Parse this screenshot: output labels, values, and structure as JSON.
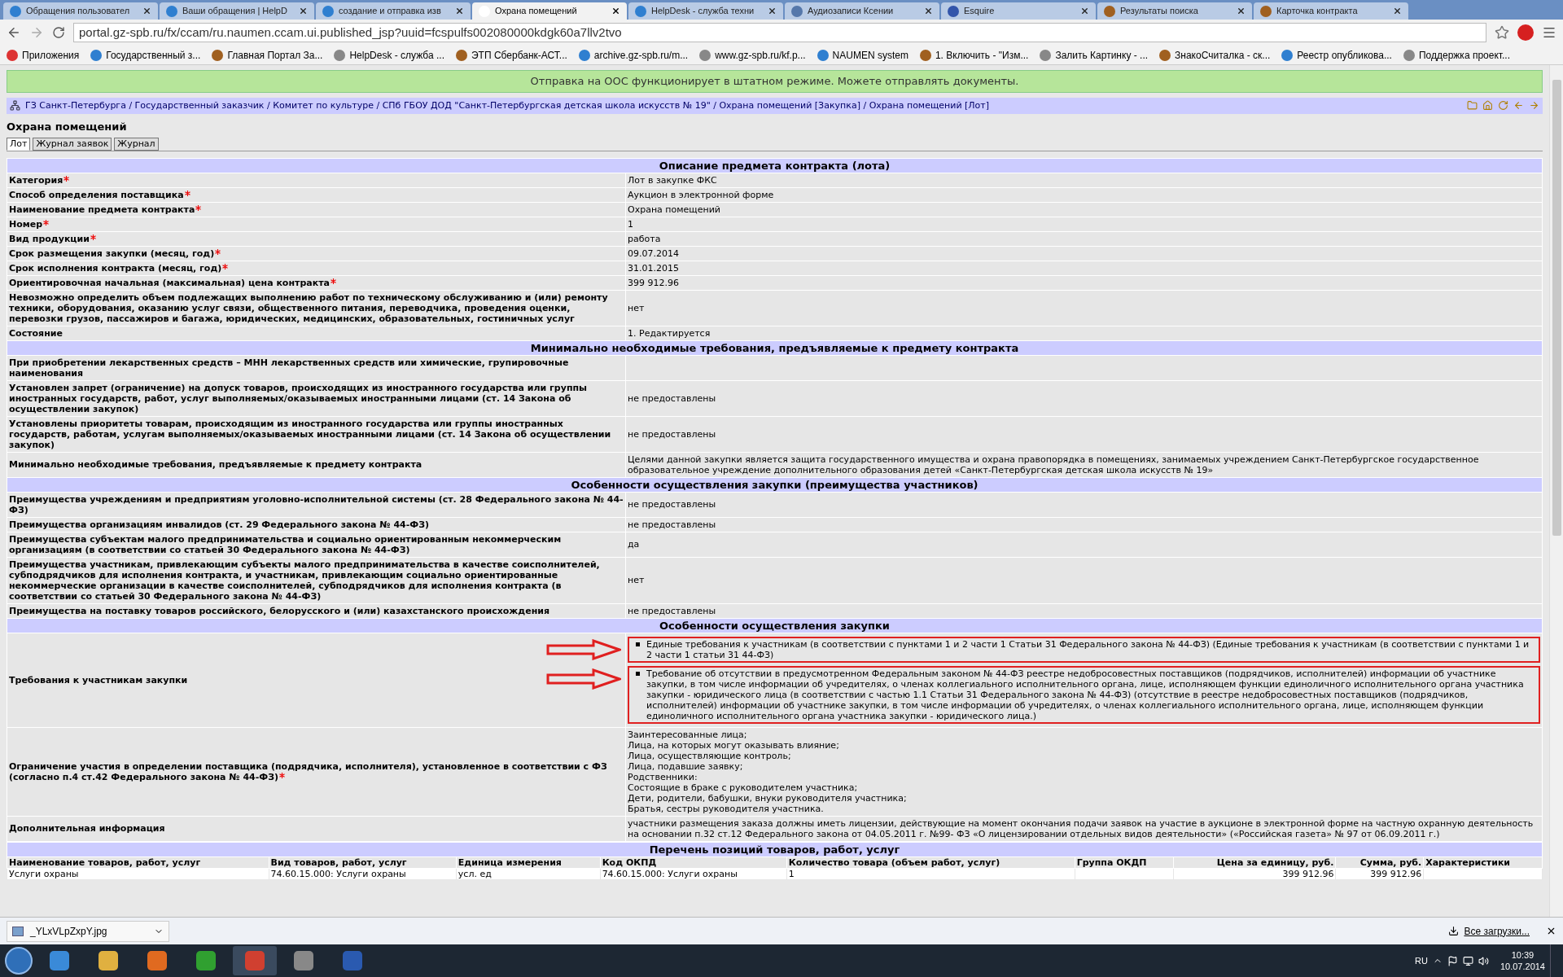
{
  "browser": {
    "tabs": [
      {
        "title": "Обращения пользовател",
        "selected": false
      },
      {
        "title": "Ваши обращения | HelpD",
        "selected": false
      },
      {
        "title": "создание и отправка изв",
        "selected": false
      },
      {
        "title": "Охрана помещений",
        "selected": true
      },
      {
        "title": "HelpDesk - служба техни",
        "selected": false
      },
      {
        "title": "Аудиозаписи Ксении",
        "selected": false
      },
      {
        "title": "Esquire",
        "selected": false
      },
      {
        "title": "Результаты поиска",
        "selected": false
      },
      {
        "title": "Карточка контракта",
        "selected": false
      }
    ],
    "url": "portal.gz-spb.ru/fx/ccam/ru.naumen.ccam.ui.published_jsp?uuid=fcspulfs002080000kdgk60a7llv2tvo",
    "bookmarks": [
      "Приложения",
      "Государственный з...",
      "Главная Портал За...",
      "HelpDesk - служба ...",
      "ЭТП Сбербанк-АСТ...",
      "archive.gz-spb.ru/m...",
      "www.gz-spb.ru/kf.p...",
      "NAUMEN system",
      "1. Включить - \"Изм...",
      "Залить Картинку - ...",
      "ЗнакоСчиталка - ск...",
      "Реестр опубликова...",
      "Поддержка проект..."
    ]
  },
  "banner": "Отправка на ООС функционирует в штатном режиме. Можете отправлять документы.",
  "breadcrumb": "ГЗ Санкт-Петербурга / Государственный заказчик / Комитет по культуре / СПб ГБОУ ДОД \"Санкт-Петербургская детская школа искусств № 19\" / Охрана помещений [Закупка] / Охрана помещений [Лот]",
  "page_title": "Охрана помещений",
  "page_tabs": [
    {
      "label": "Лот",
      "selected": true
    },
    {
      "label": "Журнал заявок",
      "selected": false
    },
    {
      "label": "Журнал",
      "selected": false
    }
  ],
  "sections": [
    {
      "title": "Описание предмета контракта (лота)",
      "rows": [
        {
          "label": "Категория",
          "required": true,
          "value": "Лот в закупке ФКС"
        },
        {
          "label": "Способ определения поставщика",
          "required": true,
          "value": "Аукцион в электронной форме"
        },
        {
          "label": "Наименование предмета контракта",
          "required": true,
          "value": "Охрана помещений"
        },
        {
          "label": "Номер",
          "required": true,
          "value": "1"
        },
        {
          "label": "Вид продукции",
          "required": true,
          "value": "работа"
        },
        {
          "label": "Срок размещения закупки (месяц, год)",
          "required": true,
          "value": "09.07.2014"
        },
        {
          "label": "Срок исполнения контракта (месяц, год)",
          "required": true,
          "value": "31.01.2015"
        },
        {
          "label": "Ориентировочная начальная (максимальная) цена контракта",
          "required": true,
          "value": "399 912.96"
        },
        {
          "label": "Невозможно определить объем подлежащих выполнению работ по техническому обслуживанию и (или) ремонту техники, оборудования, оказанию услуг связи, общественного питания, переводчика, проведения оценки, перевозки грузов, пассажиров и багажа, юридических, медицинских, образовательных, гостиничных услуг",
          "required": false,
          "value": "нет"
        },
        {
          "label": "Состояние",
          "required": false,
          "value": "1. Редактируется"
        }
      ]
    },
    {
      "title": "Минимально необходимые требования, предъявляемые к предмету контракта",
      "rows": [
        {
          "label": "При приобретении лекарственных средств – МНН лекарственных средств или химические, групировочные наименования",
          "required": false
        },
        {
          "label": "Установлен запрет (ограничение) на допуск товаров, происходящих из иностранного государства или группы иностранных государств, работ, услуг выполняемых/оказываемых иностранными лицами (ст. 14 Закона об осуществлении закупок)",
          "required": false,
          "value": "не предоставлены"
        },
        {
          "label": "Установлены приоритеты товарам, происходящим из иностранного государства или группы иностранных государств, работам, услугам выполняемых/оказываемых иностранными лицами (ст. 14 Закона об осуществлении закупок)",
          "required": false,
          "value": "не предоставлены"
        },
        {
          "label": "Минимально необходимые требования, предъявляемые к предмету контракта",
          "required": false,
          "value": "Целями данной закупки является защита государственного имущества и охрана правопорядка в помещениях, занимаемых учреждением Санкт-Петербургское государственное образовательное учреждение дополнительного образования детей «Санкт-Петербургская детская школа искусств № 19»"
        }
      ]
    },
    {
      "title": "Особенности осуществления закупки (преимущества участников)",
      "rows": [
        {
          "label": "Преимущества учреждениям и предприятиям уголовно-исполнительной системы (ст. 28 Федерального закона № 44-ФЗ)",
          "required": false,
          "value": "не предоставлены"
        },
        {
          "label": "Преимущества организациям инвалидов (ст. 29 Федерального закона № 44-ФЗ)",
          "required": false,
          "value": "не предоставлены"
        },
        {
          "label": "Преимущества субъектам малого предпринимательства и социально ориентированным некоммерческим организациям (в соответствии со статьей 30 Федерального закона № 44-ФЗ)",
          "required": false,
          "value": "да"
        },
        {
          "label": "Преимущества участникам, привлекающим субъекты малого предпринимательства в качестве соисполнителей, субподрядчиков для исполнения контракта, и участникам, привлекающим социально ориентированные некоммерческие организации в качестве соисполнителей, субподрядчиков для исполнения контракта (в соответствии со статьей 30 Федерального закона № 44-ФЗ)",
          "required": false,
          "value": "нет"
        },
        {
          "label": "Преимущества на поставку товаров российского, белорусского и (или) казахстанского происхождения",
          "required": false,
          "value": "не предоставлены"
        }
      ]
    },
    {
      "title": "Особенности осуществления закупки",
      "rows": [
        {
          "label": "Требования к участникам закупки",
          "required": false,
          "bullets": [
            {
              "text": "Единые требования к участникам (в соответствии с пунктами 1 и 2 части 1 Статьи 31 Федерального закона № 44-ФЗ) (Единые требования к участникам (в соответствии с пунктами 1 и 2 части 1 статьи 31 44-ФЗ)",
              "highlighted": true
            },
            {
              "text": "Требование об отсутствии в предусмотренном Федеральным законом № 44-ФЗ реестре недобросовестных поставщиков (подрядчиков, исполнителей) информации об участнике закупки, в том числе информации об учредителях, о членах коллегиального исполнительного органа, лице, исполняющем функции единоличного исполнительного органа участника закупки - юридического лица (в соответствии с частью 1.1 Статьи 31 Федерального закона № 44-ФЗ) (отсутствие в реестре недобросовестных поставщиков (подрядчиков, исполнителей) информации об участнике закупки, в том числе информации об учредителях, о членах коллегиального исполнительного органа, лице, исполняющем функции единоличного исполнительного органа участника закупки - юридического лица.)",
              "highlighted": true
            }
          ]
        },
        {
          "label": "Ограничение участия в определении поставщика (подрядчика, исполнителя), установленное в соответствии с ФЗ (согласно п.4 ст.42 Федерального закона № 44-ФЗ)",
          "required": true,
          "lines": [
            "Заинтересованные лица;",
            "Лица, на которых могут оказывать влияние;",
            "Лица, осуществляющие контроль;",
            "Лица, подавшие заявку;",
            "Родственники:",
            "Состоящие в браке с руководителем участника;",
            "Дети, родители, бабушки, внуки руководителя участника;",
            "Братья, сестры руководителя участника."
          ]
        },
        {
          "label": "Дополнительная информация",
          "required": false,
          "value": "участники размещения заказа должны иметь лицензии, действующие на момент окончания подачи заявок на участие в аукционе в электронной форме на частную охранную деятельность на основании п.32 ст.12 Федерального закона от 04.05.2011 г. №99- ФЗ «О лицензировании отдельных видов деятельности» («Российская газета» № 97 от 06.09.2011 г.)"
        }
      ]
    }
  ],
  "products": {
    "title": "Перечень позиций товаров, работ, услуг",
    "columns": [
      "Наименование товаров, работ, услуг",
      "Вид товаров, работ, услуг",
      "Единица измерения",
      "Код ОКПД",
      "Количество товара (объем работ, услуг)",
      "Группа ОКДП",
      "Цена за единицу, руб.",
      "Сумма, руб.",
      "Характеристики"
    ],
    "rows": [
      [
        "Услуги охраны",
        "74.60.15.000: Услуги охраны",
        "усл. ед",
        "74.60.15.000: Услуги охраны",
        "1",
        "",
        "399 912.96",
        "399 912.96",
        ""
      ]
    ]
  },
  "downloads": {
    "file": "_YLxVLpZxpY.jpg",
    "all_link": "Все загрузки..."
  },
  "taskbar": {
    "language": "RU",
    "time": "10:39",
    "date": "10.07.2014"
  }
}
